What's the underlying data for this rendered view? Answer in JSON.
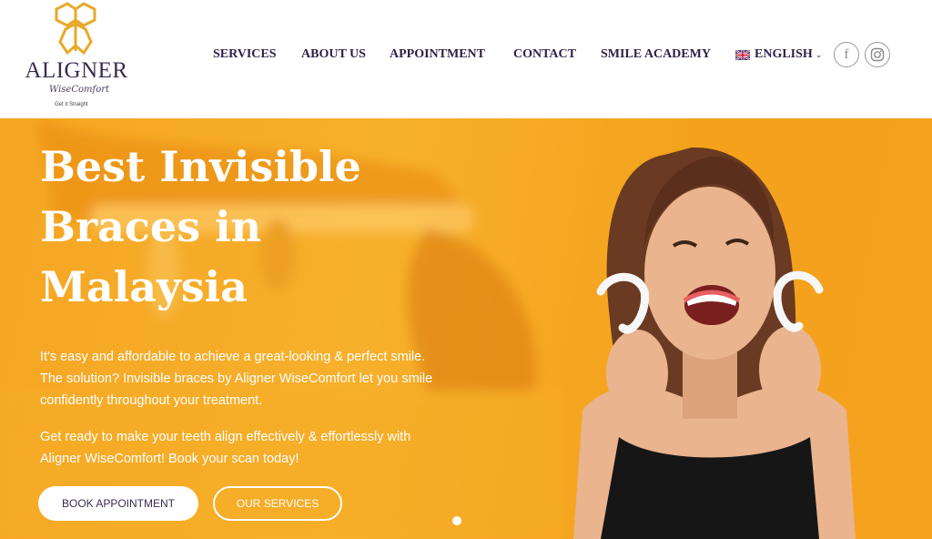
{
  "logo": {
    "brand": "ALIGNER",
    "script": "WiseComfort",
    "tagline": "Get it Straight"
  },
  "nav": {
    "items": [
      {
        "label": "SERVICES"
      },
      {
        "label": "ABOUT US"
      },
      {
        "label": "APPOINTMENT"
      },
      {
        "label": "CONTACT"
      },
      {
        "label": "SMILE ACADEMY"
      }
    ],
    "language": "ENGLISH",
    "language_icon": "uk-flag-icon",
    "social": [
      {
        "icon": "facebook-icon",
        "glyph": "f"
      },
      {
        "icon": "instagram-icon"
      }
    ]
  },
  "hero": {
    "title_lines": [
      "Best Invisible",
      "Braces in",
      "Malaysia"
    ],
    "paragraph1": "It's easy and affordable to achieve a great-looking & perfect smile. The solution? Invisible braces by Aligner WiseComfort let you smile confidently throughout your treatment.",
    "paragraph2": "Get ready to make your teeth align effectively & effortlessly with Aligner WiseComfort! Book your scan today!",
    "primary_button": "BOOK APPOINTMENT",
    "secondary_button": "OUR SERVICES"
  },
  "colors": {
    "hero_bg": "#f5a623",
    "nav_text": "#2e1f45",
    "logo_gold": "#e8a92a"
  }
}
